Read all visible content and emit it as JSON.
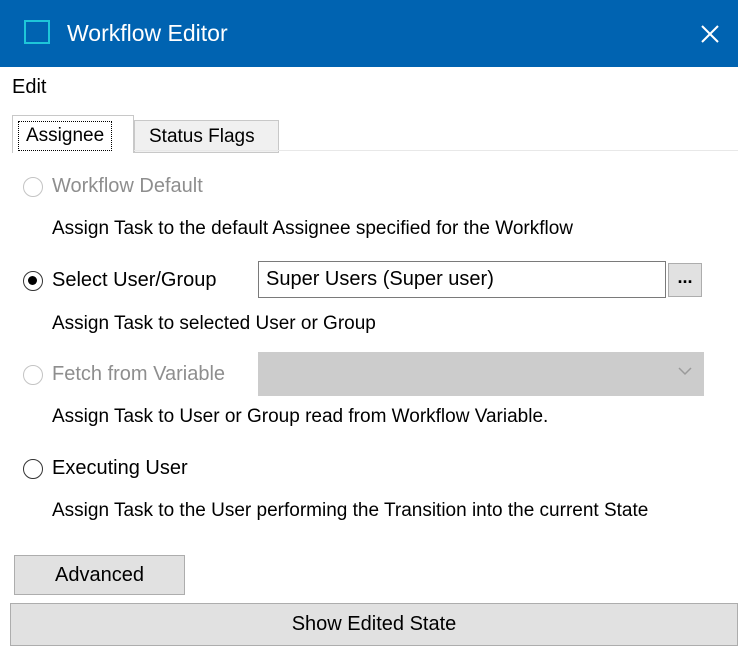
{
  "window": {
    "title": "Workflow Editor",
    "icon": "app-window-icon",
    "close_icon": "close-icon",
    "titlebar_color": "#0063b1"
  },
  "menubar": {
    "items": [
      {
        "label": "Edit"
      }
    ]
  },
  "tabs": [
    {
      "label": "Assignee",
      "selected": true
    },
    {
      "label": "Status Flags",
      "selected": false
    }
  ],
  "assignee": {
    "options": [
      {
        "label": "Workflow Default",
        "selected": false,
        "enabled": false,
        "description": "Assign Task to the default Assignee specified for the Workflow"
      },
      {
        "label": "Select User/Group",
        "selected": true,
        "enabled": true,
        "value": "Super Users (Super user)",
        "browse_label": "...",
        "description": "Assign Task to selected User or Group"
      },
      {
        "label": "Fetch from Variable",
        "selected": false,
        "enabled": false,
        "value": "",
        "description": "Assign Task to User or Group read from Workflow Variable."
      },
      {
        "label": "Executing User",
        "selected": false,
        "enabled": true,
        "description": "Assign Task to the User performing the Transition into the current State"
      }
    ]
  },
  "buttons": {
    "advanced": "Advanced",
    "show_edited_state": "Show Edited State"
  }
}
